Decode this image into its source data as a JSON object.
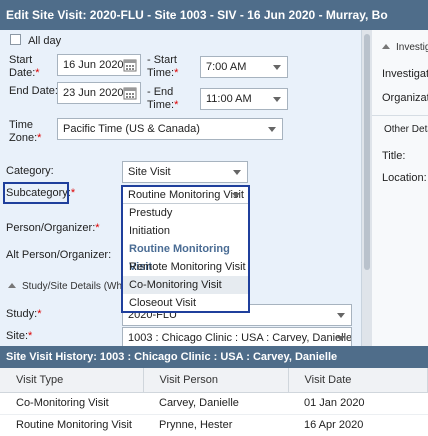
{
  "dialog": {
    "title": "Edit Site Visit: 2020-FLU - Site 1003 - SIV - 16 Jun 2020 - Murray, Bo"
  },
  "form": {
    "all_day_label": "All day",
    "start_date_label": "Start Date:",
    "start_date_value": "16 Jun 2020",
    "start_time_label": "- Start Time:",
    "start_time_value": "7:00 AM",
    "end_date_label": "End Date:",
    "end_date_value": "23 Jun 2020",
    "end_time_label": "- End Time:",
    "end_time_value": "11:00 AM",
    "timezone_label": "Time Zone:",
    "timezone_value": "Pacific Time (US & Canada)",
    "category_label": "Category:",
    "category_value": "Site Visit",
    "subcategory_label": "Subcategory:",
    "subcategory_value": "Routine Monitoring Visit",
    "person_label": "Person/Organizer:",
    "alt_person_label": "Alt Person/Organizer:",
    "study_site_section": "Study/Site Details (What",
    "study_label": "Study:",
    "study_value": "2020-FLU",
    "site_label": "Site:",
    "site_value": "1003 : Chicago Clinic : USA : Carvey, Danielle",
    "required_marker": "*"
  },
  "subcategory_options": [
    {
      "label": "Prestudy"
    },
    {
      "label": "Initiation"
    },
    {
      "label": "Routine Monitoring Visit"
    },
    {
      "label": "Remote Monitoring Visit"
    },
    {
      "label": "Co-Monitoring Visit"
    },
    {
      "label": "Closeout Visit"
    }
  ],
  "right_panel": {
    "section": "Investig",
    "investigator_label": "Investigato",
    "organization_label": "Organizatio",
    "other_details": "Other Deta",
    "title_label": "Title:",
    "location_label": "Location:"
  },
  "history": {
    "title": "Site Visit History: 1003 : Chicago Clinic : USA : Carvey, Danielle",
    "columns": [
      "Visit Type",
      "Visit Person",
      "Visit Date"
    ],
    "rows": [
      [
        "Co-Monitoring Visit",
        "Carvey, Danielle",
        "01 Jan 2020"
      ],
      [
        "Routine Monitoring Visit",
        "Prynne, Hester",
        "16 Apr 2020"
      ]
    ]
  },
  "colors": {
    "title_bar": "#4f6d8a",
    "form_bg": "#e9f1fa",
    "highlight_border": "#1f3f9c",
    "selected_option": "#4a6c94",
    "required": "#dd0000"
  }
}
